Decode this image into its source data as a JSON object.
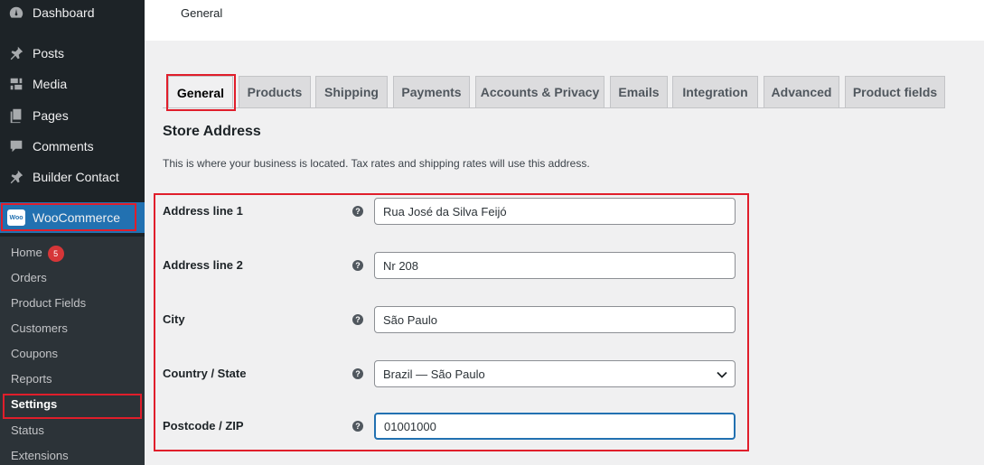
{
  "sidebar": {
    "items": [
      {
        "label": "Dashboard",
        "icon": "dashboard-icon"
      },
      {
        "label": "Posts",
        "icon": "pin-icon"
      },
      {
        "label": "Media",
        "icon": "media-icon"
      },
      {
        "label": "Pages",
        "icon": "pages-icon"
      },
      {
        "label": "Comments",
        "icon": "comment-icon"
      },
      {
        "label": "Builder Contact",
        "icon": "pin-icon"
      }
    ],
    "woocommerce": {
      "label": "WooCommerce",
      "logo_text": "Woo"
    },
    "submenu": [
      {
        "label": "Home",
        "badge": "5"
      },
      {
        "label": "Orders"
      },
      {
        "label": "Product Fields"
      },
      {
        "label": "Customers"
      },
      {
        "label": "Coupons"
      },
      {
        "label": "Reports"
      },
      {
        "label": "Settings"
      },
      {
        "label": "Status"
      },
      {
        "label": "Extensions"
      }
    ]
  },
  "header": {
    "title": "General"
  },
  "tabs": [
    {
      "label": "General"
    },
    {
      "label": "Products"
    },
    {
      "label": "Shipping"
    },
    {
      "label": "Payments"
    },
    {
      "label": "Accounts & Privacy"
    },
    {
      "label": "Emails"
    },
    {
      "label": "Integration"
    },
    {
      "label": "Advanced"
    },
    {
      "label": "Product fields"
    }
  ],
  "section": {
    "title": "Store Address",
    "description": "This is where your business is located. Tax rates and shipping rates will use this address."
  },
  "fields": [
    {
      "label": "Address line 1",
      "value": "Rua José da Silva Feijó"
    },
    {
      "label": "Address line 2",
      "value": "Nr 208"
    },
    {
      "label": "City",
      "value": "São Paulo"
    },
    {
      "label": "Country / State",
      "value": "Brazil — São Paulo"
    },
    {
      "label": "Postcode / ZIP",
      "value": "01001000"
    }
  ],
  "help_glyph": "?",
  "colors": {
    "sidebar_bg": "#1d2327",
    "accent": "#2271b1",
    "highlight": "#e01e2b",
    "badge": "#d63638"
  }
}
